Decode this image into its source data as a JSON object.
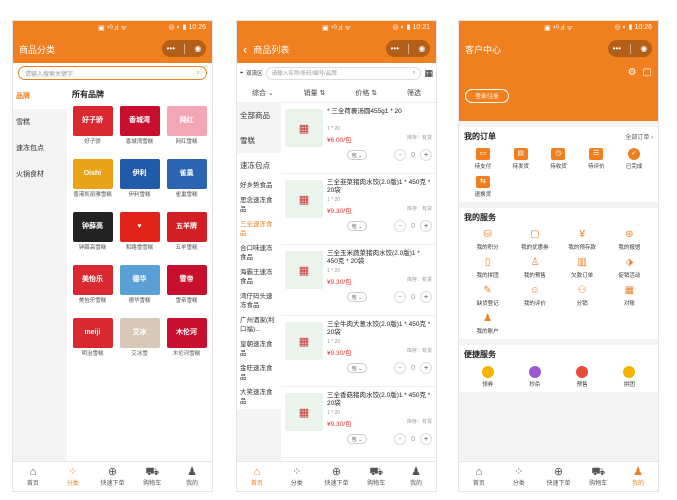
{
  "status": {
    "left": "▣ ⁴ᴳ.ıl ᯤ",
    "time1": "10:26",
    "time2": "10:21",
    "time3": "10:26",
    "icons": "◎ ◐ ▮"
  },
  "screen1": {
    "title": "商品分类",
    "search_placeholder": "请输入搜索关键字",
    "categories": [
      "品牌",
      "雪糕",
      "速冻包点",
      "火锅食材"
    ],
    "brand_title": "所有品牌",
    "brands": [
      {
        "logo": "好子骄",
        "name": "好子骄",
        "color": "#d9282f"
      },
      {
        "logo": "香城湾",
        "name": "香城湾雪糕",
        "color": "#c8102e"
      },
      {
        "logo": "网红",
        "name": "网红雪糕",
        "color": "#f4a6b5"
      },
      {
        "logo": "Oishi",
        "name": "香港凯丽雅雪糕",
        "color": "#e8a317"
      },
      {
        "logo": "伊利",
        "name": "伊利雪糕",
        "color": "#1f5ba8"
      },
      {
        "logo": "雀巢",
        "name": "雀巢雪糕",
        "color": "#2b64b0"
      },
      {
        "logo": "钟薛高",
        "name": "钟薛高雪糕",
        "color": "#222222"
      },
      {
        "logo": "♥",
        "name": "和路雪雪糕",
        "color": "#e2231a"
      },
      {
        "logo": "五羊牌",
        "name": "五羊雪糕",
        "color": "#d21f26"
      },
      {
        "logo": "美怡乐",
        "name": "美怡乐雪糕",
        "color": "#d9282f"
      },
      {
        "logo": "德华",
        "name": "德华雪糕",
        "color": "#5aa0d6"
      },
      {
        "logo": "雪帝",
        "name": "雪帝雪糕",
        "color": "#c8102e"
      },
      {
        "logo": "meiji",
        "name": "明治雪糕",
        "color": "#d9282f"
      },
      {
        "logo": "艾冰",
        "name": "艾冰雪",
        "color": "#d8c8b8"
      },
      {
        "logo": "木伦河",
        "name": "木伦河雪糕",
        "color": "#c8102e"
      }
    ]
  },
  "screen2": {
    "title": "商品列表",
    "back": "‹",
    "warehouse": "双流区",
    "search_placeholder": "请输入名称/条码/编号/品牌",
    "sort": [
      "综合",
      "销量",
      "价格",
      "筛选"
    ],
    "side": [
      {
        "label": "全部商品",
        "type": "big"
      },
      {
        "label": "雪糕",
        "type": "big"
      },
      {
        "label": "速冻包点",
        "type": "big-on"
      },
      {
        "label": "好乡势食品",
        "type": "sub"
      },
      {
        "label": "思念速冻食品",
        "type": "sub"
      },
      {
        "label": "三全速冻食品",
        "type": "sub-on"
      },
      {
        "label": "合口味速冻食品",
        "type": "sub"
      },
      {
        "label": "海霸王速冻食品",
        "type": "sub"
      },
      {
        "label": "湾仔码头速冻食品",
        "type": "sub"
      },
      {
        "label": "广州酒家(利口福)...",
        "type": "sub"
      },
      {
        "label": "皇朝速冻食品",
        "type": "sub"
      },
      {
        "label": "金旺速冻食品",
        "type": "sub"
      },
      {
        "label": "大笑速冻食品",
        "type": "sub"
      }
    ],
    "products": [
      {
        "name": "* 三全荷裹汤圆455g1 * 20",
        "spec": "1 * 20",
        "price": "¥6.00/包",
        "stock": "库存：有货",
        "unit": "包 ⌄",
        "qty": "0"
      },
      {
        "name": "三全韭菜猪肉水饺(2.0版)1 * 450克 * 20袋",
        "spec": "1 * 20",
        "price": "¥9.30/包",
        "stock": "库存：有货",
        "unit": "包 ⌄",
        "qty": "0"
      },
      {
        "name": "三全玉米蔬菜猪肉水饺(2.0版)1 * 450克 * 20袋",
        "spec": "1 * 20",
        "price": "¥9.30/包",
        "stock": "库存：有货",
        "unit": "包 ⌄",
        "qty": "0"
      },
      {
        "name": "三全牛肉大葱水饺(2.0版)1 * 450克 * 20袋",
        "spec": "1 * 20",
        "price": "¥9.30/包",
        "stock": "库存：有货",
        "unit": "包 ⌄",
        "qty": "0"
      },
      {
        "name": "三全香菇猪肉水饺(2.0版)1 * 450克 * 20袋",
        "spec": "1 * 20",
        "price": "¥9.30/包",
        "stock": "库存：有货",
        "unit": "包 ⌄",
        "qty": "0"
      }
    ]
  },
  "screen3": {
    "title": "客户中心",
    "login": "登录/注册",
    "orders_title": "我的订单",
    "orders_more": "全部订单 ›",
    "orders": [
      {
        "label": "待支付",
        "icon": "▭"
      },
      {
        "label": "待发货",
        "icon": "▤"
      },
      {
        "label": "待收货",
        "icon": "◷"
      },
      {
        "label": "待评价",
        "icon": "☰"
      },
      {
        "label": "已完成",
        "icon": "✓"
      },
      {
        "label": "退换货",
        "icon": "⇆"
      }
    ],
    "services_title": "我的服务",
    "services": [
      {
        "label": "我的积分",
        "icon": "⛁"
      },
      {
        "label": "我的优惠券",
        "icon": "▢"
      },
      {
        "label": "我的预存款",
        "icon": "¥"
      },
      {
        "label": "我的报馆",
        "icon": "⊛"
      },
      {
        "label": "我的拼团",
        "icon": "▯"
      },
      {
        "label": "我的预售",
        "icon": "♙"
      },
      {
        "label": "欠款订单",
        "icon": "▥"
      },
      {
        "label": "促销活动",
        "icon": "⬗"
      },
      {
        "label": "缺货登记",
        "icon": "✎"
      },
      {
        "label": "我的评价",
        "icon": "☺"
      },
      {
        "label": "分销",
        "icon": "⚇"
      },
      {
        "label": "对账",
        "icon": "▦"
      },
      {
        "label": "我的账户",
        "icon": "♟"
      }
    ],
    "convenience_title": "便捷服务",
    "convenience": [
      "领券",
      "秒杀",
      "预售",
      "拼团"
    ]
  },
  "tabbar": [
    {
      "label": "首页",
      "icon": "⌂"
    },
    {
      "label": "分类",
      "icon": "⁘"
    },
    {
      "label": "快速下单",
      "icon": "⊕"
    },
    {
      "label": "购物车",
      "icon": "⛟"
    },
    {
      "label": "我的",
      "icon": "♟"
    }
  ]
}
